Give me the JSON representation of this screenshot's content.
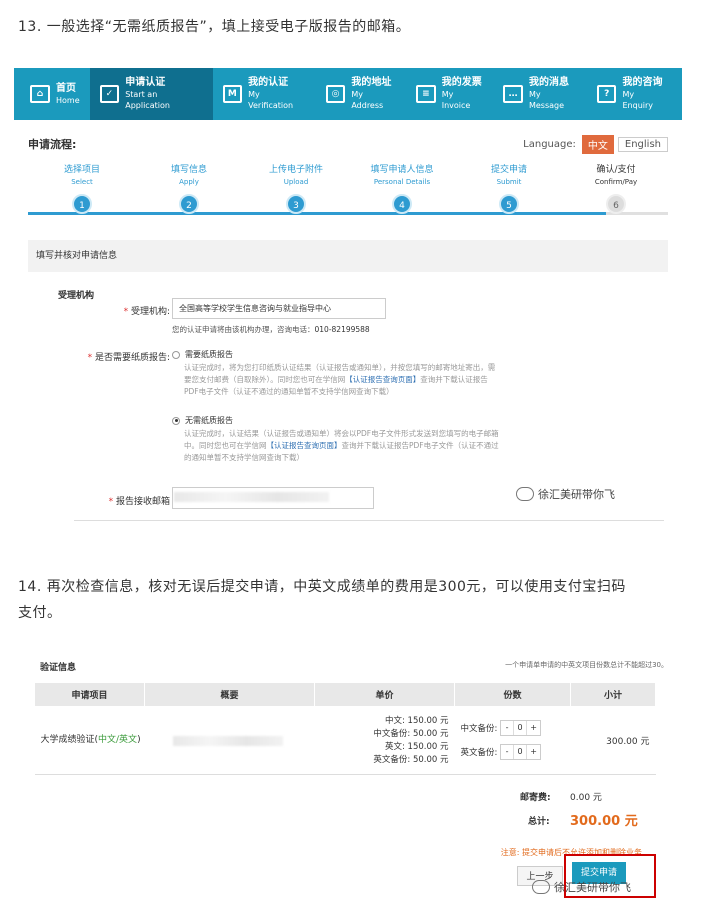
{
  "captions": {
    "step13": "13. 一般选择“无需纸质报告”，填上接受电子版报告的邮箱。",
    "step14_l1": "14. 再次检查信息，核对无误后提交申请，中英文成绩单的费用是300元，可以使用支付宝扫码",
    "step14_l2": "支付。"
  },
  "nav": [
    {
      "t": "首页",
      "s": "Home",
      "icon": "home-icon"
    },
    {
      "t": "申请认证",
      "s": "Start an Application",
      "icon": "checkbox-icon"
    },
    {
      "t": "我的认证",
      "s": "My Verification",
      "icon": "id-card-icon"
    },
    {
      "t": "我的地址",
      "s": "My Address",
      "icon": "location-icon"
    },
    {
      "t": "我的发票",
      "s": "My Invoice",
      "icon": "invoice-icon"
    },
    {
      "t": "我的消息",
      "s": "My Message",
      "icon": "message-icon"
    },
    {
      "t": "我的咨询",
      "s": "My Enquiry",
      "icon": "question-icon"
    }
  ],
  "process_title": "申请流程:",
  "language": {
    "label": "Language:",
    "zh": "中文",
    "en": "English"
  },
  "steps": [
    {
      "l": "选择项目",
      "s": "Select",
      "n": "1"
    },
    {
      "l": "填写信息",
      "s": "Apply",
      "n": "2"
    },
    {
      "l": "上传电子附件",
      "s": "Upload",
      "n": "3"
    },
    {
      "l": "填写申请人信息",
      "s": "Personal Details",
      "n": "4"
    },
    {
      "l": "提交申请",
      "s": "Submit",
      "n": "5"
    },
    {
      "l": "确认/支付",
      "s": "Confirm/Pay",
      "n": "6"
    }
  ],
  "form": {
    "section": "填写并核对申请信息",
    "agency_heading": "受理机构",
    "agency_label": "受理机构:",
    "agency_value": "全国高等学校学生信息咨询与就业指导中心",
    "agency_note": "您的认证申请将由该机构办理，咨询电话：",
    "agency_phone": "010-82199588",
    "paper_label": "是否需要纸质报告:",
    "opt1": "需要纸质报告",
    "opt1_d1": "认证完成时，将为您打印纸质认证结果（认证报告或通知单），并按您填写的邮寄地址寄出，需",
    "opt1_d2": "要您支付邮费（自取除外）。同时您也可在学信网",
    "opt1_link": "【认证报告查询页面】",
    "opt1_d3": "查询并下载认证报告",
    "opt1_d4": "PDF电子文件（认证不通过的通知单暂不支持学信网查询下载）",
    "opt2": "无需纸质报告",
    "opt2_d1": "认证完成时，认证结果（认证报告或通知单）将会以PDF电子文件形式发送到您填写的电子邮箱",
    "opt2_d2": "中。同时您也可在学信网",
    "opt2_link": "【认证报告查询页面】",
    "opt2_d3": "查询并下载认证报告PDF电子文件（认证不通过",
    "opt2_d4": "的通知单暂不支持学信网查询下载）",
    "email_label": "报告接收邮箱"
  },
  "watermark": "徐汇美研带你飞",
  "verify": {
    "title": "验证信息",
    "note": "一个申请单申请的中英文项目份数总计不能超过30。",
    "headers": [
      "申请项目",
      "概要",
      "单价",
      "份数",
      "小计"
    ],
    "item": "大学成绩验证(",
    "item_green": "中文/英文",
    "item_end": ")",
    "prices": [
      "中文: 150.00 元",
      "中文备份: 50.00 元",
      "英文: 150.00 元",
      "英文备份: 50.00 元"
    ],
    "q1": "中文备份:",
    "q2": "英文备份:",
    "q_minus": "-",
    "q_val": "0",
    "q_plus": "+",
    "subtotal": "300.00 元",
    "postage_label": "邮寄费:",
    "postage": "0.00 元",
    "total_label": "总计:",
    "total": "300.00 元",
    "warn": "注意: 提交申请后不允许添加和删除业务",
    "prev": "上一步",
    "submit": "提交申请"
  },
  "colors": {
    "nav": "#1b9abd",
    "accent": "#2e9bd1",
    "orange": "#e26a1c"
  }
}
